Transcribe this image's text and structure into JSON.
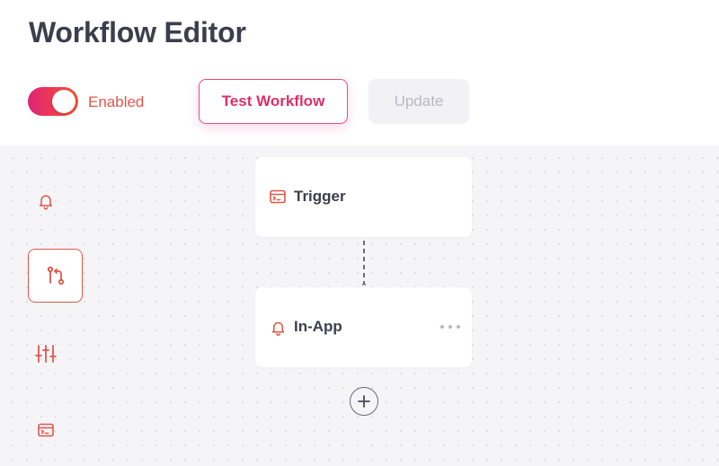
{
  "header": {
    "title": "Workflow Editor",
    "toggle": {
      "label": "Enabled",
      "on": true
    },
    "test_button_label": "Test Workflow",
    "update_button_label": "Update"
  },
  "sidebar": {
    "items": [
      {
        "icon": "bell-icon",
        "active": false
      },
      {
        "icon": "branch-icon",
        "active": true
      },
      {
        "icon": "sliders-icon",
        "active": false
      },
      {
        "icon": "terminal-window-icon",
        "active": false
      }
    ]
  },
  "workflow": {
    "nodes": [
      {
        "label": "Trigger",
        "icon": "terminal-window-icon"
      },
      {
        "label": "In-App",
        "icon": "bell-icon"
      }
    ],
    "add_step_icon": "plus-icon"
  },
  "colors": {
    "accent_start": "#dd2476",
    "accent_end": "#ff512f",
    "accent_red": "#e0564b",
    "title": "#3d3d4e",
    "canvas_bg": "#f5f5f7"
  }
}
